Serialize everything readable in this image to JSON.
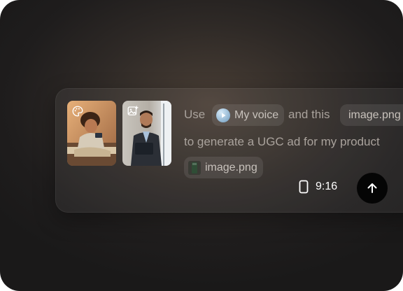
{
  "prompt": {
    "word_use": "Use",
    "voice_chip_label": "My voice",
    "word_and_this": "and this",
    "image_chip_1_label": "image.png",
    "line2": "to generate a UGC ad for my product",
    "image_chip_2_label": "image.png"
  },
  "thumbnails": [
    {
      "icon": "palette-icon",
      "subject": "child-with-phone"
    },
    {
      "icon": "image-add-icon",
      "subject": "man-with-tablet"
    }
  ],
  "controls": {
    "aspect_ratio_icon": "phone-portrait-icon",
    "aspect_ratio": "9:16",
    "send_icon": "arrow-up-icon"
  },
  "colors": {
    "background": "#1f1d1d",
    "panel": "#2f2b29",
    "text_muted": "#a9a29c",
    "send_button": "#050505"
  }
}
